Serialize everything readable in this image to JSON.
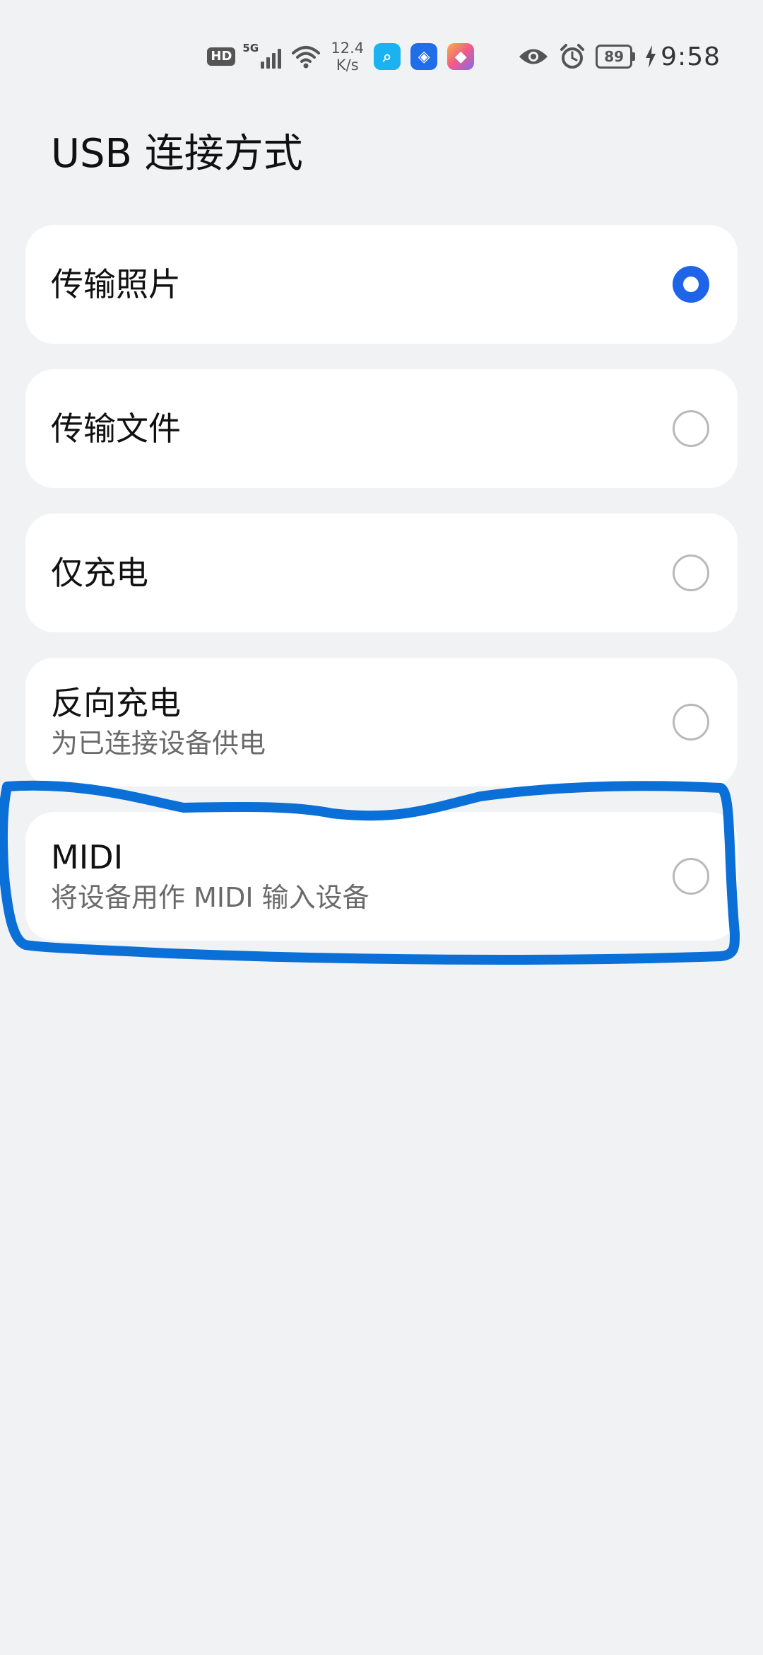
{
  "status_bar": {
    "hd": "HD",
    "network_type": "5G",
    "speed_value": "12.4",
    "speed_unit": "K/s",
    "apps": [
      {
        "icon": "search-icon",
        "color": "#1ab2f0",
        "glyph": "⌕"
      },
      {
        "icon": "lightbulb-icon",
        "color": "#1f6ee8",
        "glyph": "◈"
      },
      {
        "icon": "app-icon",
        "color": "#f05a8a",
        "glyph": "◆"
      }
    ],
    "battery": "89",
    "time": "9:58"
  },
  "page": {
    "title": "USB 连接方式"
  },
  "options": [
    {
      "label": "传输照片",
      "desc": "",
      "selected": true
    },
    {
      "label": "传输文件",
      "desc": "",
      "selected": false
    },
    {
      "label": "仅充电",
      "desc": "",
      "selected": false
    },
    {
      "label": "反向充电",
      "desc": "为已连接设备供电",
      "selected": false
    },
    {
      "label": "MIDI",
      "desc": "将设备用作 MIDI 输入设备",
      "selected": false
    }
  ],
  "colors": {
    "accent": "#1e64e8",
    "annotation": "#0a6fd6",
    "background": "#f1f2f4"
  }
}
